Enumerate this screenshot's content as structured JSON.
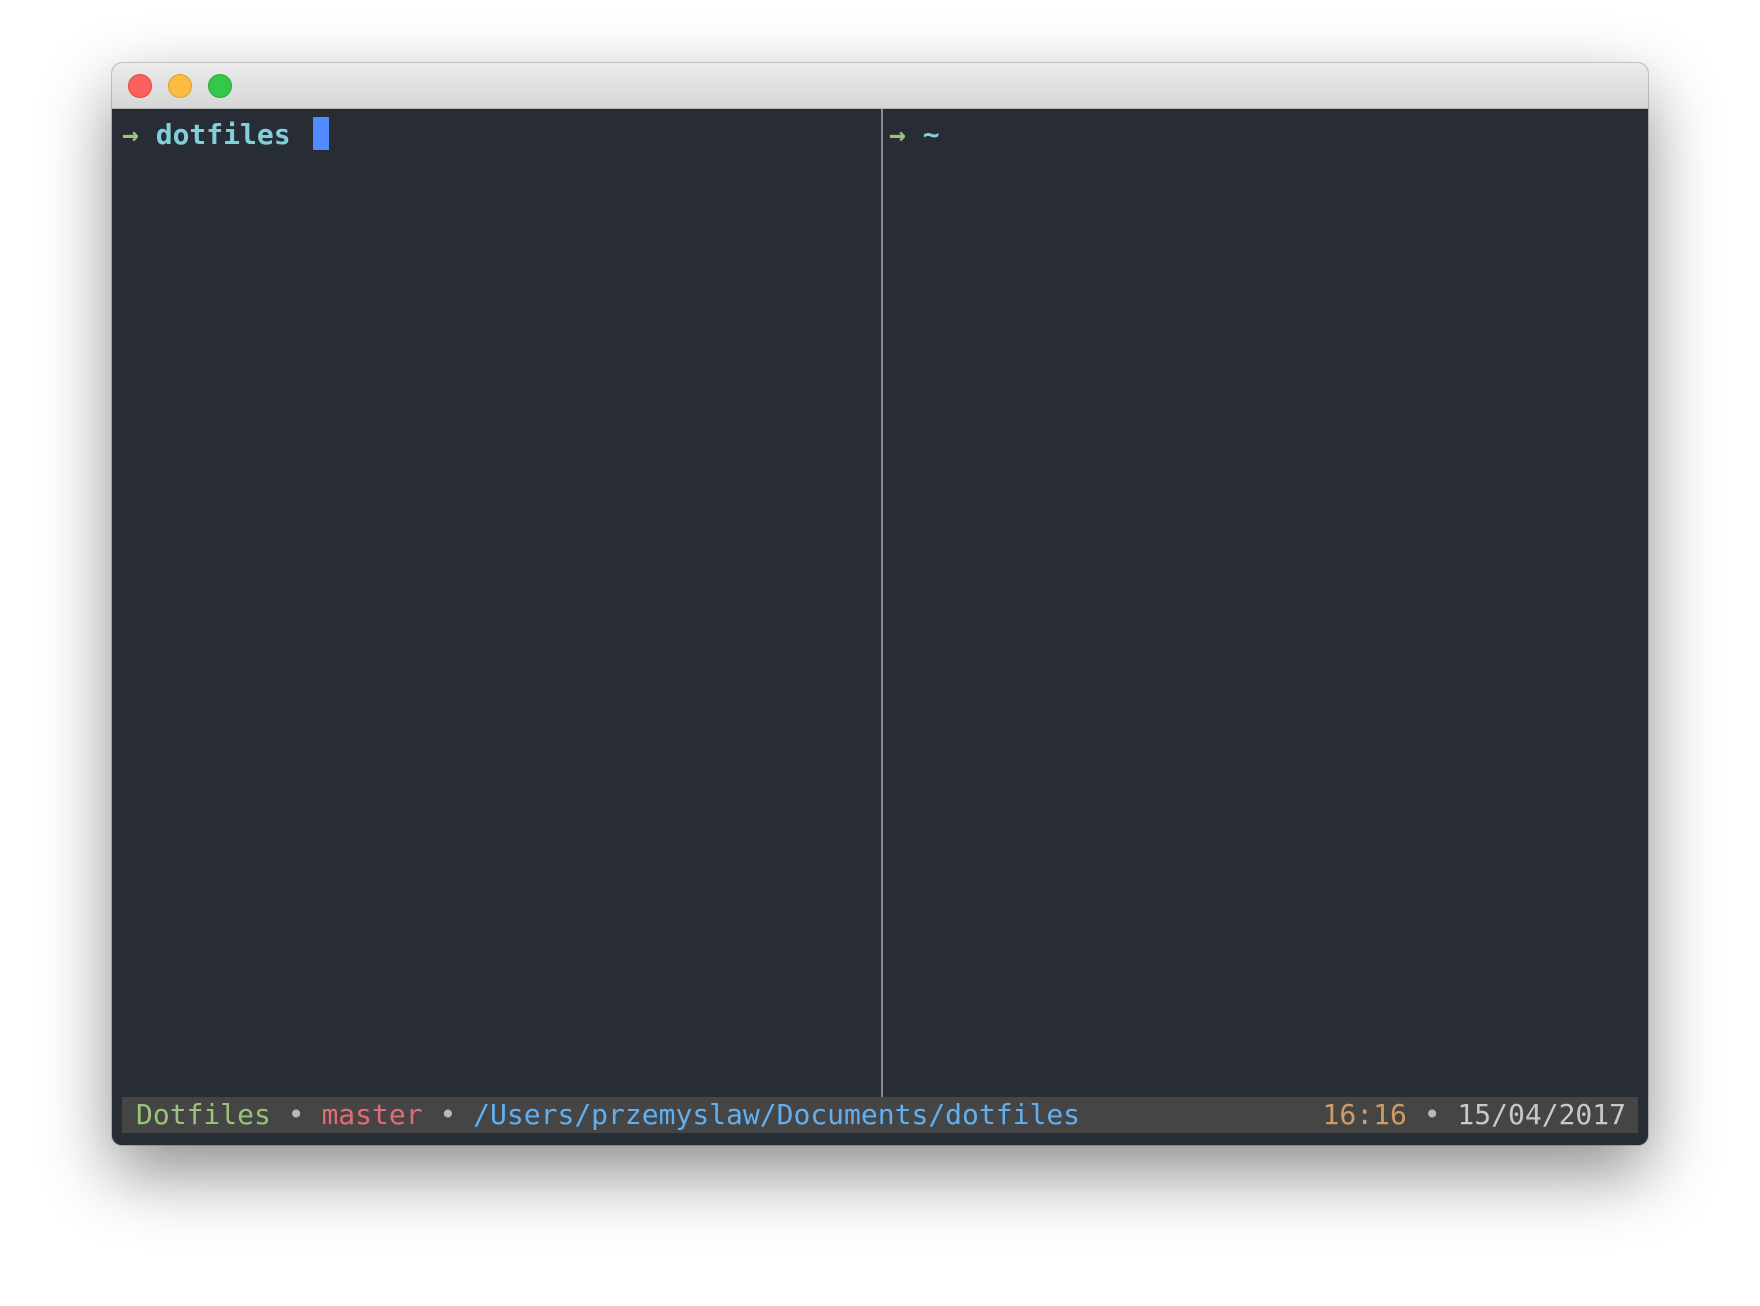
{
  "window": {
    "controls": {
      "close": "close-button",
      "minimize": "minimize-button",
      "zoom": "zoom-button"
    }
  },
  "panes": {
    "left": {
      "prompt_arrow": "→",
      "directory": "dotfiles"
    },
    "right": {
      "prompt_arrow": "→",
      "directory": "~"
    }
  },
  "statusbar": {
    "session": "Dotfiles",
    "branch": "master",
    "path": "/Users/przemyslaw/Documents/dotfiles",
    "time": "16:16",
    "date": "15/04/2017",
    "separator": "•"
  },
  "colors": {
    "background": "#282c34",
    "prompt_arrow": "#98c379",
    "directory": "#7fd0dc",
    "cursor": "#528bff",
    "status_session": "#98c379",
    "status_branch": "#e06c75",
    "status_path": "#61afef",
    "status_time": "#d19a66",
    "status_bar": "#454545"
  }
}
